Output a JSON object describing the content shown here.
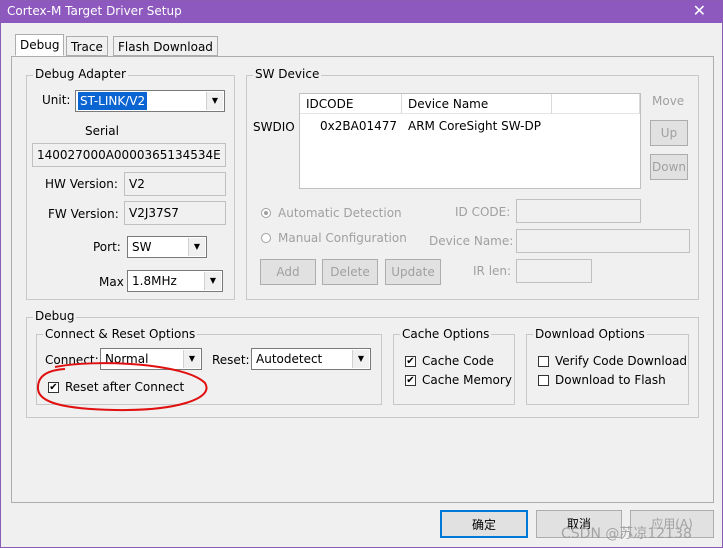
{
  "window": {
    "title": "Cortex-M Target Driver Setup",
    "close_glyph": "✕"
  },
  "tabs": [
    {
      "label": "Debug",
      "active": true
    },
    {
      "label": "Trace",
      "active": false
    },
    {
      "label": "Flash Download",
      "active": false
    }
  ],
  "debug_adapter": {
    "title": "Debug Adapter",
    "unit_label": "Unit:",
    "unit_value": "ST-LINK/V2",
    "serial_label": "Serial",
    "serial_value": "140027000A0000365134534E",
    "hw_label": "HW Version:",
    "hw_value": "V2",
    "fw_label": "FW Version:",
    "fw_value": "V2J37S7",
    "port_label": "Port:",
    "port_value": "SW",
    "max_label": "Max",
    "max_value": "1.8MHz"
  },
  "sw_device": {
    "title": "SW Device",
    "swdio_label": "SWDIO",
    "columns": [
      "IDCODE",
      "Device Name"
    ],
    "rows": [
      {
        "idcode": "0x2BA01477",
        "device": "ARM CoreSight SW-DP"
      }
    ],
    "move_label": "Move",
    "up_label": "Up",
    "down_label": "Down",
    "auto_detect_label": "Automatic Detection",
    "manual_config_label": "Manual Configuration",
    "id_code_label": "ID CODE:",
    "device_name_label": "Device Name:",
    "ir_len_label": "IR len:",
    "add_label": "Add",
    "delete_label": "Delete",
    "update_label": "Update"
  },
  "debug": {
    "title": "Debug",
    "connect_reset": {
      "title": "Connect & Reset Options",
      "connect_label": "Connect:",
      "connect_value": "Normal",
      "reset_label": "Reset:",
      "reset_value": "Autodetect",
      "reset_after_connect_label": "Reset after Connect",
      "reset_after_connect_checked": true
    },
    "cache": {
      "title": "Cache Options",
      "cache_code_label": "Cache Code",
      "cache_code_checked": true,
      "cache_memory_label": "Cache Memory",
      "cache_memory_checked": true
    },
    "download": {
      "title": "Download Options",
      "verify_label": "Verify Code Download",
      "verify_checked": false,
      "flash_label": "Download to Flash",
      "flash_checked": false
    }
  },
  "footer": {
    "ok_label": "确定",
    "cancel_label": "取消",
    "apply_label": "应用(A)",
    "watermark": "CSDN @苏凉12138"
  },
  "colors": {
    "titlebar": "#8d59be",
    "selection": "#0a64d2",
    "annotation": "#e01010"
  }
}
